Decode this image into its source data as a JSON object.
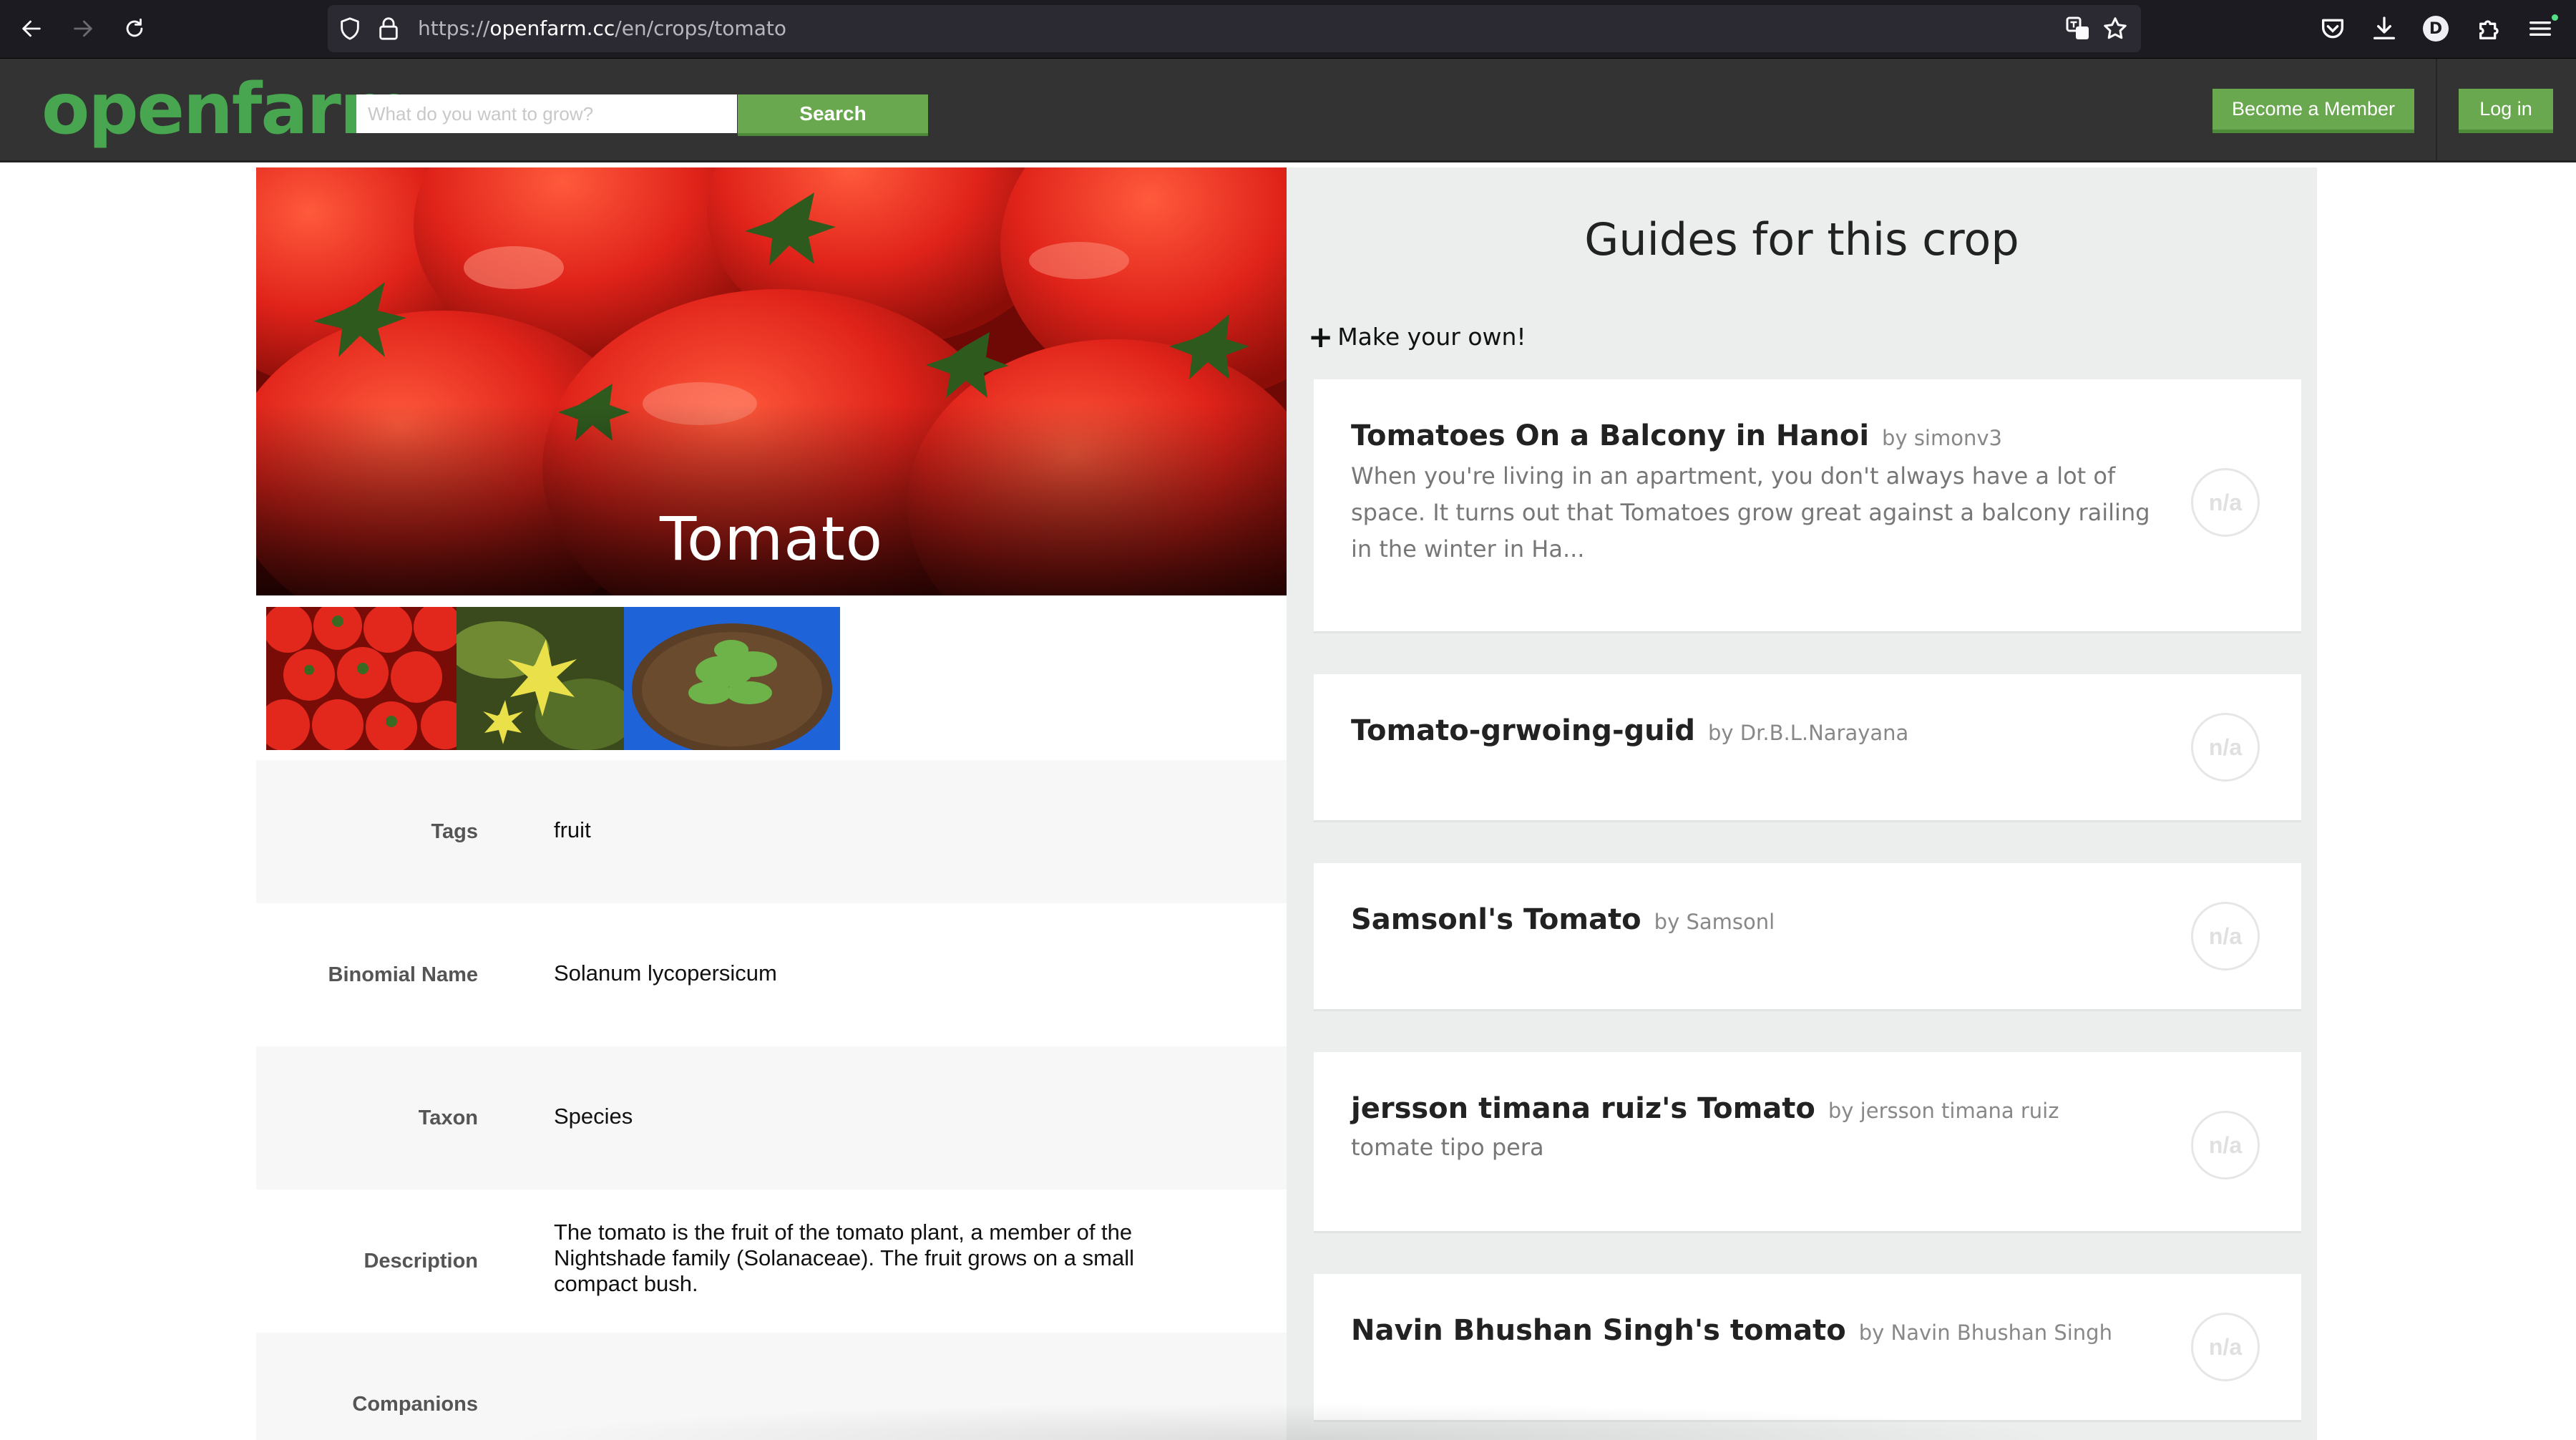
{
  "browser": {
    "url_prefix": "https://",
    "url_host": "openfarm.cc",
    "url_path": "/en/crops/tomato",
    "account_initial": "D"
  },
  "header": {
    "logo": "openfarm",
    "search_placeholder": "What do you want to grow?",
    "search_label": "Search",
    "member_label": "Become a Member",
    "login_label": "Log in"
  },
  "crop": {
    "name": "Tomato",
    "attributes": {
      "tags_label": "Tags",
      "tags_value": "fruit",
      "binomial_label": "Binomial Name",
      "binomial_value": "Solanum lycopersicum",
      "taxon_label": "Taxon",
      "taxon_value": "Species",
      "description_label": "Description",
      "description_value": "The tomato is the fruit of the tomato plant, a member of the Nightshade family (Solanaceae). The fruit grows on a small compact bush.",
      "companions_label": "Companions"
    }
  },
  "guides": {
    "title": "Guides for this crop",
    "make_own": "Make your own!",
    "items": [
      {
        "title": "Tomatoes On a Balcony in Hanoi",
        "author": "by simonv3",
        "description": "When you're living in an apartment, you don't always have a lot of space. It turns out that Tomatoes grow great against a balcony railing in the winter in Ha...",
        "score": "n/a"
      },
      {
        "title": "Tomato-grwoing-guid",
        "author": "by Dr.B.L.Narayana",
        "description": "",
        "score": "n/a"
      },
      {
        "title": "Samsonl's Tomato",
        "author": "by Samsonl",
        "description": "",
        "score": "n/a"
      },
      {
        "title": "jersson timana ruiz's Tomato",
        "author": "by jersson timana ruiz",
        "description": "tomate tipo pera",
        "score": "n/a"
      },
      {
        "title": "Navin Bhushan Singh's tomato",
        "author": "by Navin Bhushan Singh",
        "description": "",
        "score": "n/a"
      }
    ]
  },
  "colors": {
    "brand_green": "#47a64f",
    "button_green": "#6aa84f",
    "header_bg": "#333333",
    "panel_bg": "#eceeee"
  }
}
